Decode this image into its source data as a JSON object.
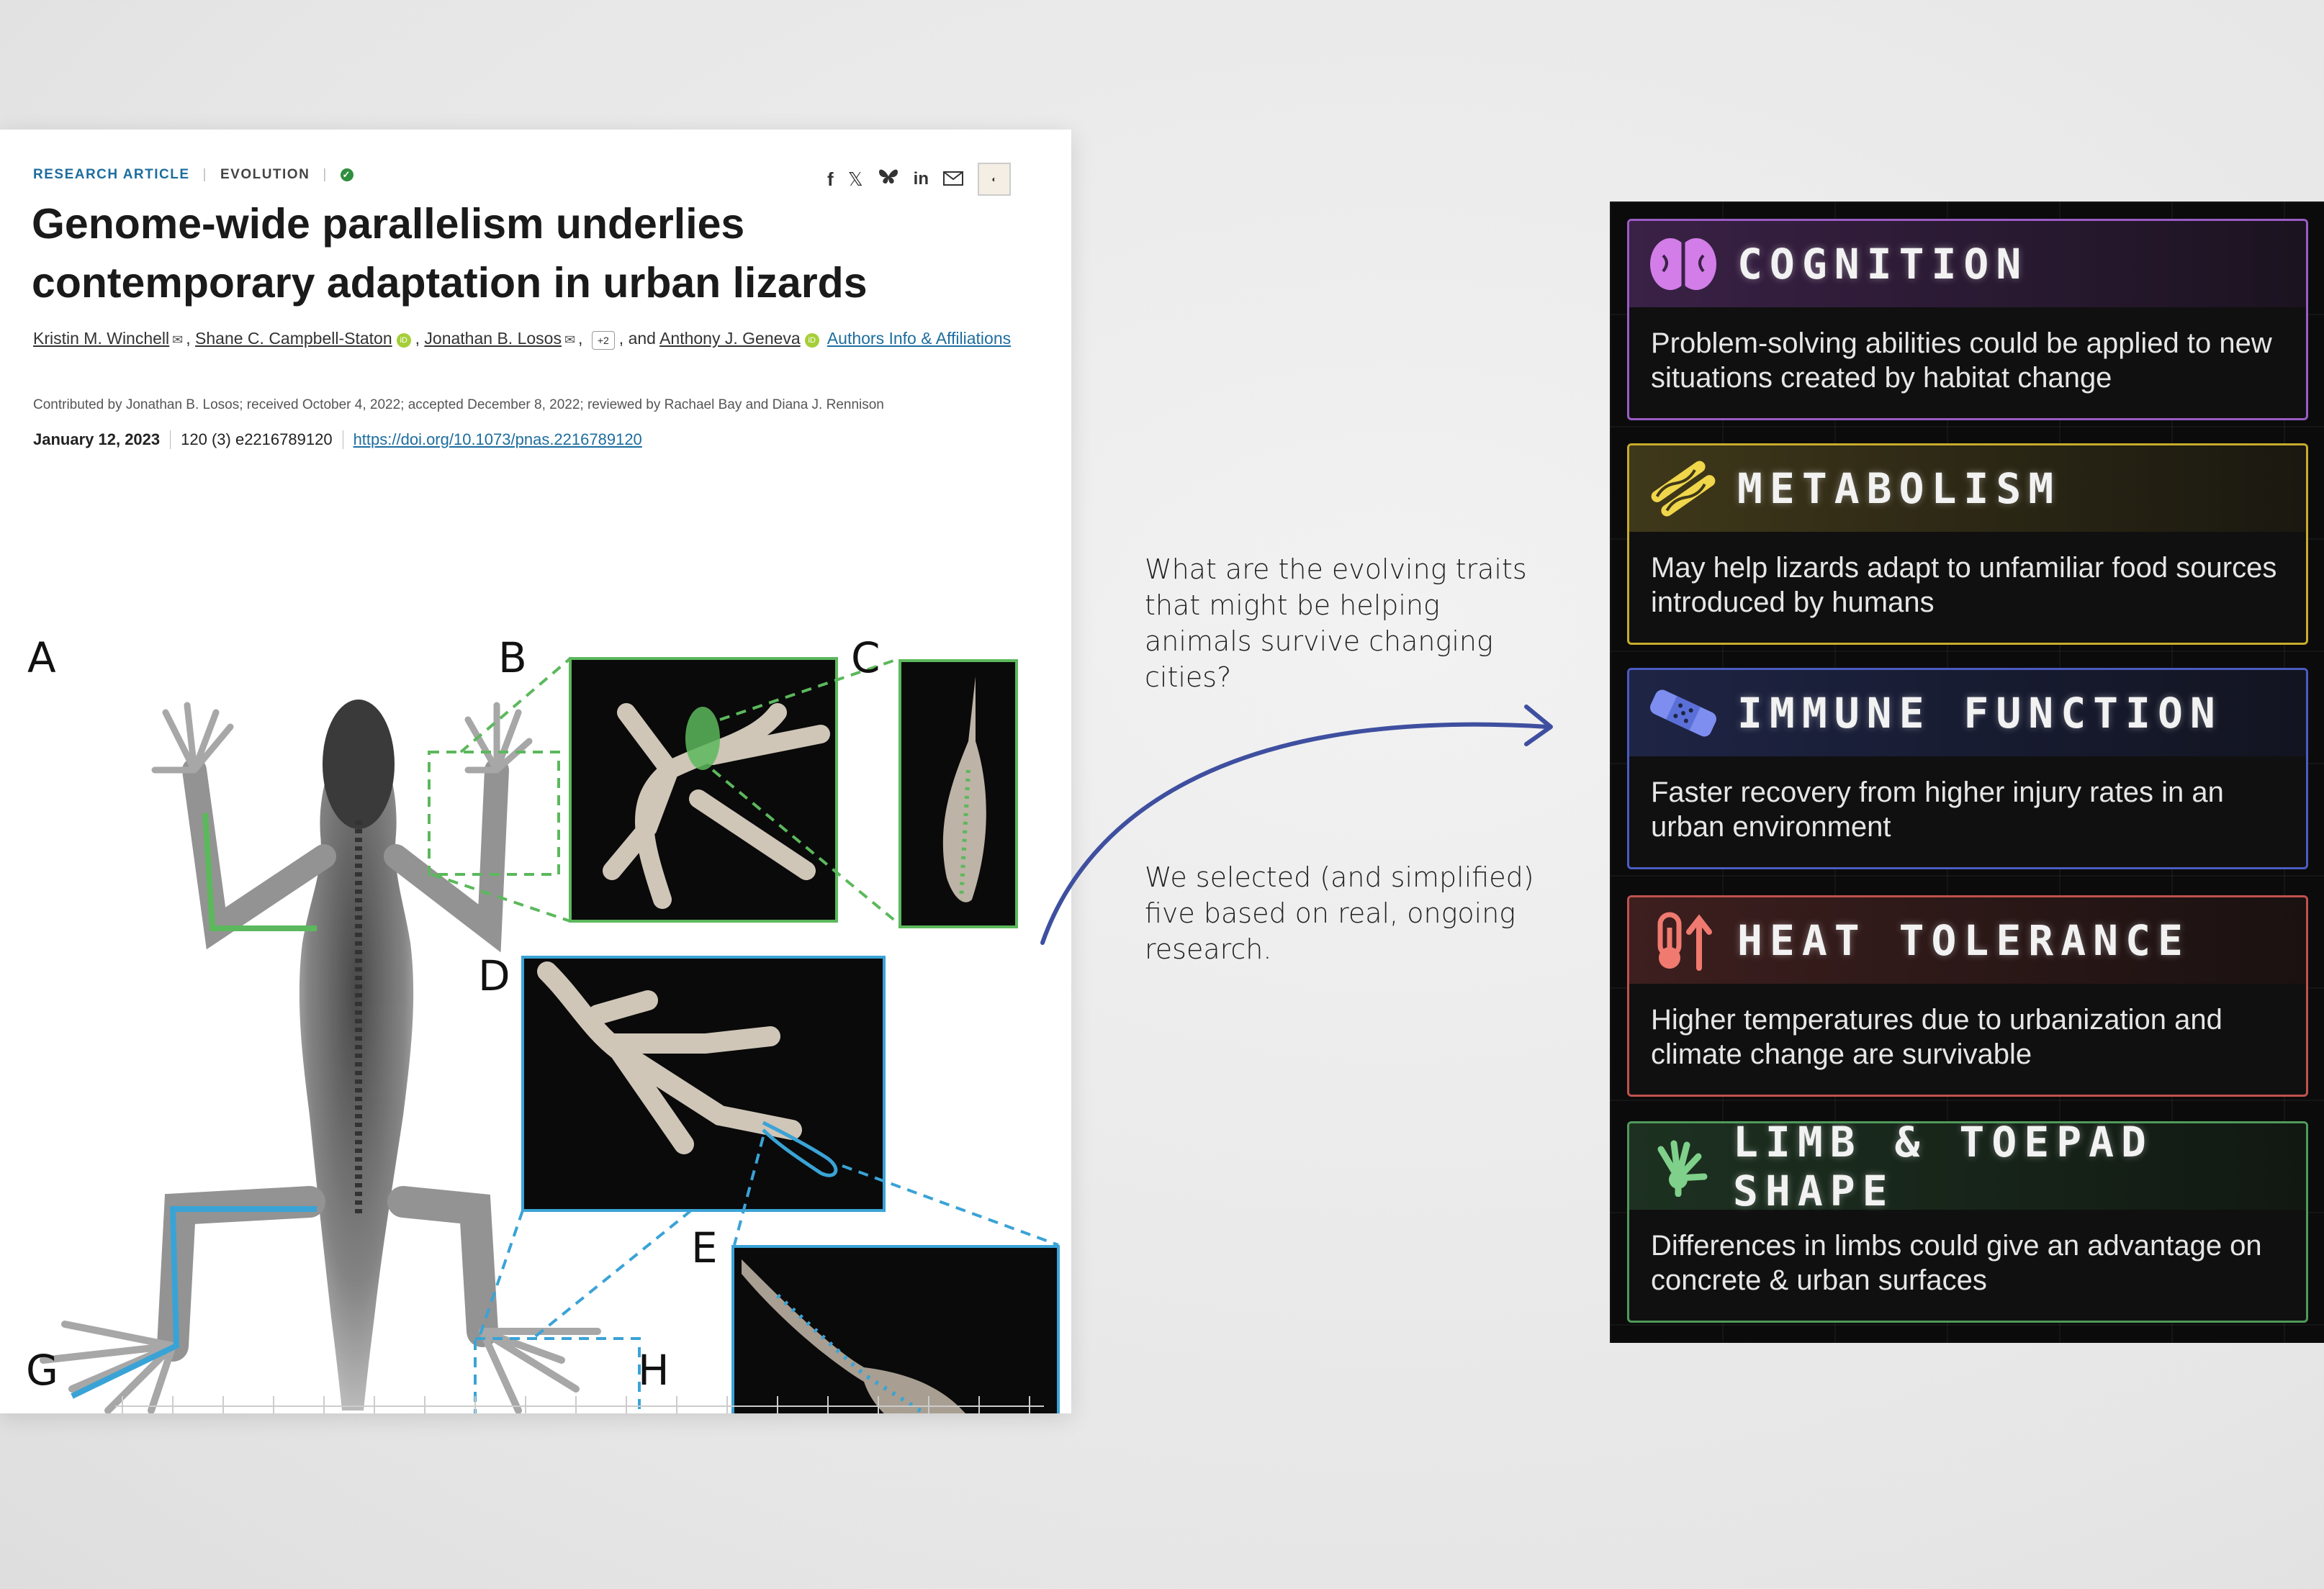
{
  "paper": {
    "article_type": "RESEARCH ARTICLE",
    "subject": "EVOLUTION",
    "title": "Genome-wide parallelism underlies contemporary adaptation in urban lizards",
    "authors": [
      "Kristin M. Winchell",
      "Shane C. Campbell-Staton",
      "Jonathan B. Losos",
      "Anthony J. Geneva"
    ],
    "more_authors": "+2",
    "and_text": ", and",
    "authors_info": "Authors Info & Affiliations",
    "contributed": "Contributed by Jonathan B. Losos; received October 4, 2022; accepted December 8, 2022; reviewed by Rachael Bay and Diana J. Rennison",
    "date": "January 12, 2023",
    "volume": "120 (3) e2216789120",
    "doi": "https://doi.org/10.1073/pnas.2216789120",
    "share_icons": [
      "facebook-icon",
      "x-icon",
      "bluesky-icon",
      "linkedin-icon",
      "email-icon"
    ],
    "figure_labels": [
      "A",
      "B",
      "C",
      "D",
      "E",
      "G",
      "H"
    ]
  },
  "middle": {
    "question": "What are the evolving traits that might be helping animals survive changing cities?",
    "note": "We selected (and simplified) five based on real, ongoing research."
  },
  "traits": [
    {
      "name": "COGNITION",
      "description": "Problem-solving abilities could be applied to new situations created by habitat change",
      "color": "#b36bd6",
      "icon": "brain-icon"
    },
    {
      "name": "METABOLISM",
      "description": "May help lizards adapt to unfamiliar food sources introduced by humans",
      "color": "#d8c23a",
      "icon": "food-icon"
    },
    {
      "name": "IMMUNE FUNCTION",
      "description": "Faster recovery from higher injury rates in an urban environment",
      "color": "#5b6fd8",
      "icon": "bandage-icon"
    },
    {
      "name": "HEAT TOLERANCE",
      "description": "Higher temperatures due to urbanization and climate change are survivable",
      "color": "#d8605a",
      "icon": "thermometer-icon"
    },
    {
      "name": "LIMB & TOEPAD SHAPE",
      "description": "Differences in limbs could give an advantage on concrete & urban surfaces",
      "color": "#5fae6a",
      "icon": "lizard-foot-icon"
    }
  ]
}
